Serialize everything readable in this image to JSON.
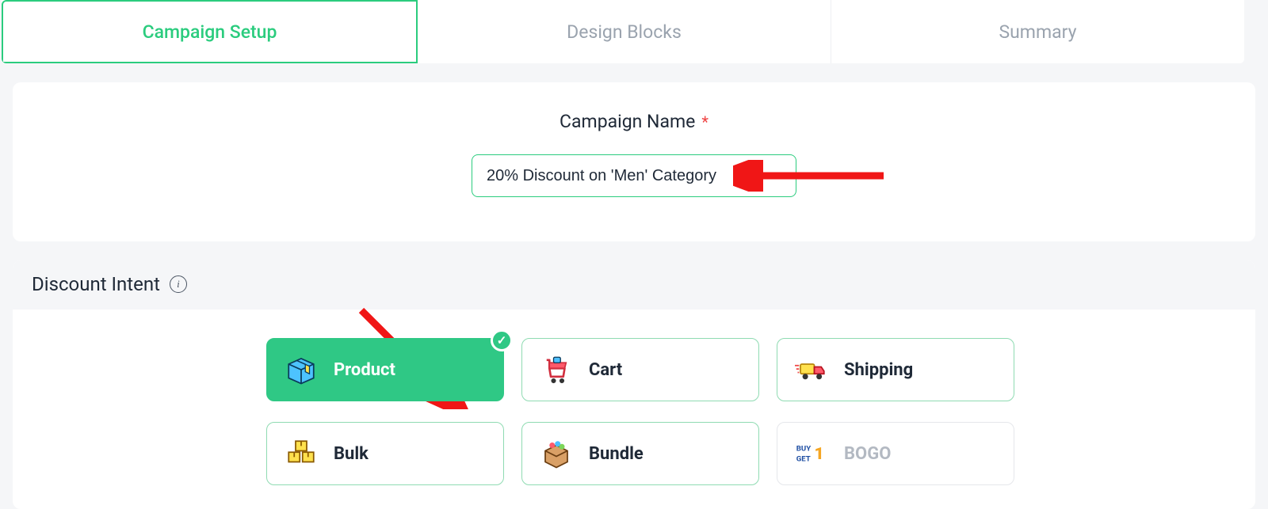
{
  "tabs": [
    {
      "label": "Campaign Setup",
      "active": true
    },
    {
      "label": "Design Blocks",
      "active": false
    },
    {
      "label": "Summary",
      "active": false
    }
  ],
  "campaign": {
    "label": "Campaign Name",
    "required_marker": "*",
    "value": "20% Discount on 'Men' Category"
  },
  "intent": {
    "title": "Discount Intent",
    "options": [
      {
        "key": "product",
        "label": "Product",
        "selected": true,
        "disabled": false,
        "icon": "box-icon"
      },
      {
        "key": "cart",
        "label": "Cart",
        "selected": false,
        "disabled": false,
        "icon": "cart-icon"
      },
      {
        "key": "shipping",
        "label": "Shipping",
        "selected": false,
        "disabled": false,
        "icon": "truck-icon"
      },
      {
        "key": "bulk",
        "label": "Bulk",
        "selected": false,
        "disabled": false,
        "icon": "boxes-icon"
      },
      {
        "key": "bundle",
        "label": "Bundle",
        "selected": false,
        "disabled": false,
        "icon": "bundle-icon"
      },
      {
        "key": "bogo",
        "label": "BOGO",
        "selected": false,
        "disabled": true,
        "icon": "bogo-icon"
      }
    ]
  },
  "colors": {
    "accent": "#2bcc7e",
    "annotation": "#f01616"
  }
}
